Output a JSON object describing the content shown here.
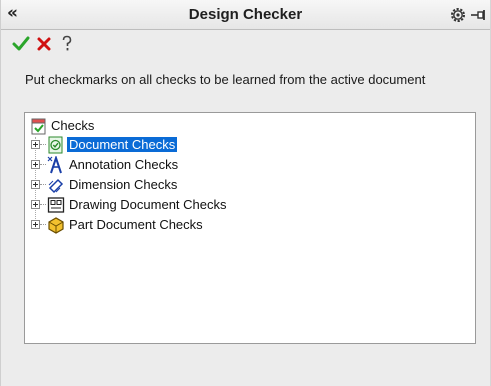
{
  "panel": {
    "title": "Design Checker"
  },
  "instruction": "Put checkmarks on all checks to be learned from the active document",
  "tree": {
    "root_label": "Checks",
    "items": [
      {
        "label": "Document Checks",
        "icon": "document-check-icon",
        "selected": true
      },
      {
        "label": "Annotation Checks",
        "icon": "annotation-icon",
        "selected": false
      },
      {
        "label": "Dimension Checks",
        "icon": "dimension-icon",
        "selected": false
      },
      {
        "label": "Drawing Document Checks",
        "icon": "drawing-document-icon",
        "selected": false
      },
      {
        "label": "Part Document Checks",
        "icon": "part-document-icon",
        "selected": false
      }
    ]
  },
  "colors": {
    "selection": "#0a6bd6",
    "ok_green": "#2aa52a",
    "cancel_red": "#d01010"
  }
}
